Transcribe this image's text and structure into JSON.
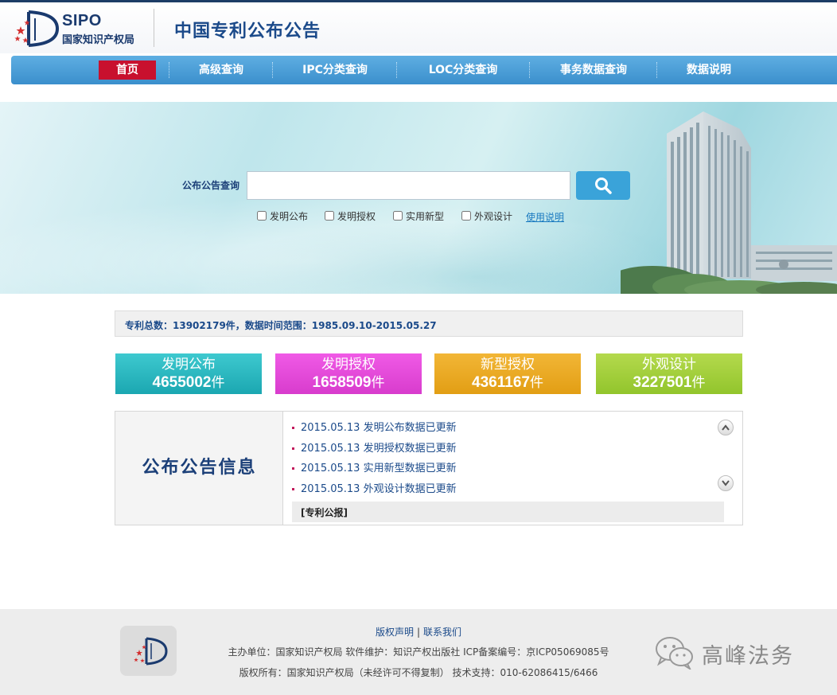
{
  "header": {
    "logo_en": "SIPO",
    "logo_cn": "国家知识产权局",
    "site_title": "中国专利公布公告"
  },
  "nav": {
    "items": [
      {
        "label": "首页",
        "active": true
      },
      {
        "label": "高级查询"
      },
      {
        "label": "IPC分类查询"
      },
      {
        "label": "LOC分类查询"
      },
      {
        "label": "事务数据查询"
      },
      {
        "label": "数据说明"
      }
    ]
  },
  "search": {
    "label": "公布公告查询",
    "value": "",
    "options": [
      "发明公布",
      "发明授权",
      "实用新型",
      "外观设计"
    ],
    "help": "使用说明"
  },
  "stats": {
    "text": "专利总数：13902179件，数据时间范围：1985.09.10-2015.05.27"
  },
  "tiles": [
    {
      "name": "发明公布",
      "count": "4655002",
      "unit": "件",
      "color": "#23b6bf"
    },
    {
      "name": "发明授权",
      "count": "1658509",
      "unit": "件",
      "color": "#e44ad9"
    },
    {
      "name": "新型授权",
      "count": "4361167",
      "unit": "件",
      "color": "#eaa823"
    },
    {
      "name": "外观设计",
      "count": "3227501",
      "unit": "件",
      "color": "#a0cd3a"
    }
  ],
  "notice": {
    "title": "公布公告信息",
    "items": [
      "2015.05.13 发明公布数据已更新",
      "2015.05.13 发明授权数据已更新",
      "2015.05.13 实用新型数据已更新",
      "2015.05.13 外观设计数据已更新"
    ],
    "gazette": "[专利公报]"
  },
  "footer": {
    "link_copyright": "版权声明",
    "link_divider": "|",
    "link_contact": "联系我们",
    "line1": "主办单位：国家知识产权局 软件维护：知识产权出版社 ICP备案编号：京ICP05069085号",
    "line2": "版权所有：国家知识产权局（未经许可不得复制） 技术支持：010-62086415/6466",
    "watermark": "高峰法务"
  },
  "colors": {
    "nav_bg": "#3b8fcc",
    "nav_active": "#c8102e",
    "search_button": "#3aa3d9",
    "title_blue": "#1b4a8a"
  }
}
